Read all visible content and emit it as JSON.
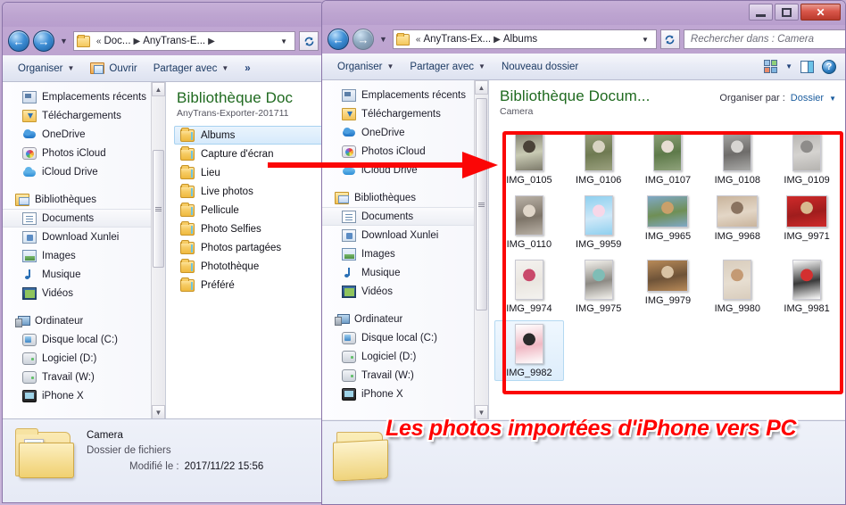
{
  "window_left": {
    "controls": {
      "minimize": "—",
      "maximize": "❐",
      "close": "✕"
    },
    "address": {
      "crumb_prefix": "«",
      "crumb1": "Doc...",
      "crumb_sep": "▶",
      "crumb2": "AnyTrans-E...",
      "crumb_sep2": "▶",
      "dropdown_caret": "▼",
      "refresh_label": "↻"
    },
    "toolbar": {
      "organiser": "Organiser",
      "organiser_caret": "▼",
      "ouvrir": "Ouvrir",
      "partager": "Partager avec",
      "partager_caret": "▼",
      "overflow": "»"
    },
    "nav": {
      "items": [
        {
          "label": "Emplacements récents",
          "icon": "recent-places-icon",
          "indent": "child"
        },
        {
          "label": "Téléchargements",
          "icon": "downloads-icon",
          "indent": "child"
        },
        {
          "label": "OneDrive",
          "icon": "onedrive-icon",
          "indent": "child"
        },
        {
          "label": "Photos iCloud",
          "icon": "icloud-photos-icon",
          "indent": "child"
        },
        {
          "label": "iCloud Drive",
          "icon": "icloud-drive-icon",
          "indent": "child"
        }
      ],
      "libraries_header": {
        "label": "Bibliothèques",
        "icon": "libraries-icon"
      },
      "libraries": [
        {
          "label": "Documents",
          "icon": "documents-icon",
          "selected": true
        },
        {
          "label": "Download Xunlei",
          "icon": "download-xunlei-icon",
          "selected": false
        },
        {
          "label": "Images",
          "icon": "pictures-icon",
          "selected": false
        },
        {
          "label": "Musique",
          "icon": "music-icon",
          "selected": false
        },
        {
          "label": "Vidéos",
          "icon": "videos-icon",
          "selected": false
        }
      ],
      "computer_header": {
        "label": "Ordinateur",
        "icon": "computer-icon"
      },
      "drives": [
        {
          "label": "Disque local (C:)",
          "icon": "system-drive-icon"
        },
        {
          "label": "Logiciel (D:)",
          "icon": "drive-icon"
        },
        {
          "label": "Travail (W:)",
          "icon": "drive-icon"
        },
        {
          "label": "iPhone X",
          "icon": "iphone-icon"
        }
      ]
    },
    "content": {
      "title": "Bibliothèque Doc",
      "subtitle": "AnyTrans-Exporter-201711",
      "folders": [
        {
          "label": "Albums",
          "selected": true
        },
        {
          "label": "Capture d'écran",
          "selected": false
        },
        {
          "label": "Lieu",
          "selected": false
        },
        {
          "label": "Live photos",
          "selected": false
        },
        {
          "label": "Pellicule",
          "selected": false
        },
        {
          "label": "Photo Selfies",
          "selected": false
        },
        {
          "label": "Photos partagées",
          "selected": false
        },
        {
          "label": "Photothèque",
          "selected": false
        },
        {
          "label": "Préféré",
          "selected": false
        }
      ]
    },
    "details": {
      "name": "Camera",
      "type": "Dossier de fichiers",
      "modified_label": "Modifié le :",
      "modified_value": "2017/11/22 15:56"
    }
  },
  "window_right": {
    "controls": {
      "minimize": "—",
      "maximize": "❐",
      "close": "✕"
    },
    "address": {
      "crumb_prefix": "«",
      "crumb1": "AnyTrans-Ex...",
      "crumb_sep": "▶",
      "crumb2": "Albums",
      "dropdown_caret": "▼",
      "refresh_label": "↻"
    },
    "search": {
      "placeholder": "Rechercher dans : Camera",
      "icon": "search-icon"
    },
    "toolbar": {
      "organiser": "Organiser",
      "organiser_caret": "▼",
      "partager": "Partager avec",
      "partager_caret": "▼",
      "nouveau_dossier": "Nouveau dossier",
      "view_caret": "▼",
      "view_icon": "change-view-icon",
      "preview_icon": "preview-pane-icon",
      "help_icon": "help-icon"
    },
    "nav": {
      "items": [
        {
          "label": "Emplacements récents",
          "icon": "recent-places-icon",
          "indent": "child"
        },
        {
          "label": "Téléchargements",
          "icon": "downloads-icon",
          "indent": "child"
        },
        {
          "label": "OneDrive",
          "icon": "onedrive-icon",
          "indent": "child"
        },
        {
          "label": "Photos iCloud",
          "icon": "icloud-photos-icon",
          "indent": "child"
        },
        {
          "label": "iCloud Drive",
          "icon": "icloud-drive-icon",
          "indent": "child"
        }
      ],
      "libraries_header": {
        "label": "Bibliothèques",
        "icon": "libraries-icon"
      },
      "libraries": [
        {
          "label": "Documents",
          "icon": "documents-icon",
          "selected": true
        },
        {
          "label": "Download Xunlei",
          "icon": "download-xunlei-icon",
          "selected": false
        },
        {
          "label": "Images",
          "icon": "pictures-icon",
          "selected": false
        },
        {
          "label": "Musique",
          "icon": "music-icon",
          "selected": false
        },
        {
          "label": "Vidéos",
          "icon": "videos-icon",
          "selected": false
        }
      ],
      "computer_header": {
        "label": "Ordinateur",
        "icon": "computer-icon"
      },
      "drives": [
        {
          "label": "Disque local (C:)",
          "icon": "system-drive-icon"
        },
        {
          "label": "Logiciel (D:)",
          "icon": "drive-icon"
        },
        {
          "label": "Travail (W:)",
          "icon": "drive-icon"
        },
        {
          "label": "iPhone X",
          "icon": "iphone-icon"
        }
      ]
    },
    "content": {
      "title": "Bibliothèque Docum...",
      "subtitle": "Camera",
      "organiser_par_label": "Organiser par :",
      "organiser_par_value": "Dossier",
      "organiser_par_caret": "▼",
      "thumbnails": [
        {
          "name": "IMG_0105",
          "orient": "portrait",
          "selected": false,
          "c1": "#7d7a6b",
          "c2": "#4a4238",
          "c3": "#c9cbb4"
        },
        {
          "name": "IMG_0106",
          "orient": "portrait",
          "selected": false,
          "c1": "#9aa07e",
          "c2": "#d8d3c2",
          "c3": "#6f7a52"
        },
        {
          "name": "IMG_0107",
          "orient": "portrait",
          "selected": false,
          "c1": "#8fa27b",
          "c2": "#e6ddd2",
          "c3": "#5e7a4a"
        },
        {
          "name": "IMG_0108",
          "orient": "portrait",
          "selected": false,
          "c1": "#a9a9a7",
          "c2": "#d7d5d2",
          "c3": "#6e6c6a"
        },
        {
          "name": "IMG_0109",
          "orient": "portrait",
          "selected": false,
          "c1": "#b5b3b0",
          "c2": "#8e8c8a",
          "c3": "#d5d3d0"
        },
        {
          "name": "IMG_0110",
          "orient": "portrait",
          "selected": false,
          "c1": "#b9b1a6",
          "c2": "#e0d6c9",
          "c3": "#7d7468"
        },
        {
          "name": "IMG_9959",
          "orient": "portrait",
          "selected": false,
          "c1": "#8fd0ef",
          "c2": "#f7d7e8",
          "c3": "#cfe8f8"
        },
        {
          "name": "IMG_9965",
          "orient": "landscape",
          "selected": false,
          "c1": "#7fa8c6",
          "c2": "#c9a06a",
          "c3": "#6f8f55"
        },
        {
          "name": "IMG_9968",
          "orient": "landscape",
          "selected": false,
          "c1": "#c9b49c",
          "c2": "#8a7360",
          "c3": "#e3d6c6"
        },
        {
          "name": "IMG_9971",
          "orient": "landscape",
          "selected": false,
          "c1": "#cf2a2a",
          "c2": "#d8b98f",
          "c3": "#a01d1d"
        },
        {
          "name": "IMG_9974",
          "orient": "portrait",
          "selected": false,
          "c1": "#f4f2ef",
          "c2": "#c9496b",
          "c3": "#eae6e0"
        },
        {
          "name": "IMG_9975",
          "orient": "portrait",
          "selected": false,
          "c1": "#f3f1ec",
          "c2": "#7fbdb6",
          "c3": "#8d8a84"
        },
        {
          "name": "IMG_9979",
          "orient": "landscape",
          "selected": false,
          "c1": "#b88a58",
          "c2": "#d9c3a4",
          "c3": "#6e5338"
        },
        {
          "name": "IMG_9980",
          "orient": "portrait",
          "selected": false,
          "c1": "#d9cdbd",
          "c2": "#c49a74",
          "c3": "#e7ded1"
        },
        {
          "name": "IMG_9981",
          "orient": "portrait",
          "selected": false,
          "c1": "#fdfdfd",
          "c2": "#d33030",
          "c3": "#3a3a3a"
        },
        {
          "name": "IMG_9982",
          "orient": "portrait",
          "selected": true,
          "c1": "#ffffff",
          "c2": "#2a2a2a",
          "c3": "#f0b9c4"
        }
      ]
    }
  },
  "annotations": {
    "caption": "Les photos importées  d'iPhone vers PC",
    "arrow_name": "red-arrow",
    "highlight_box_name": "red-highlight-box",
    "accent_red": "#fb0606"
  }
}
